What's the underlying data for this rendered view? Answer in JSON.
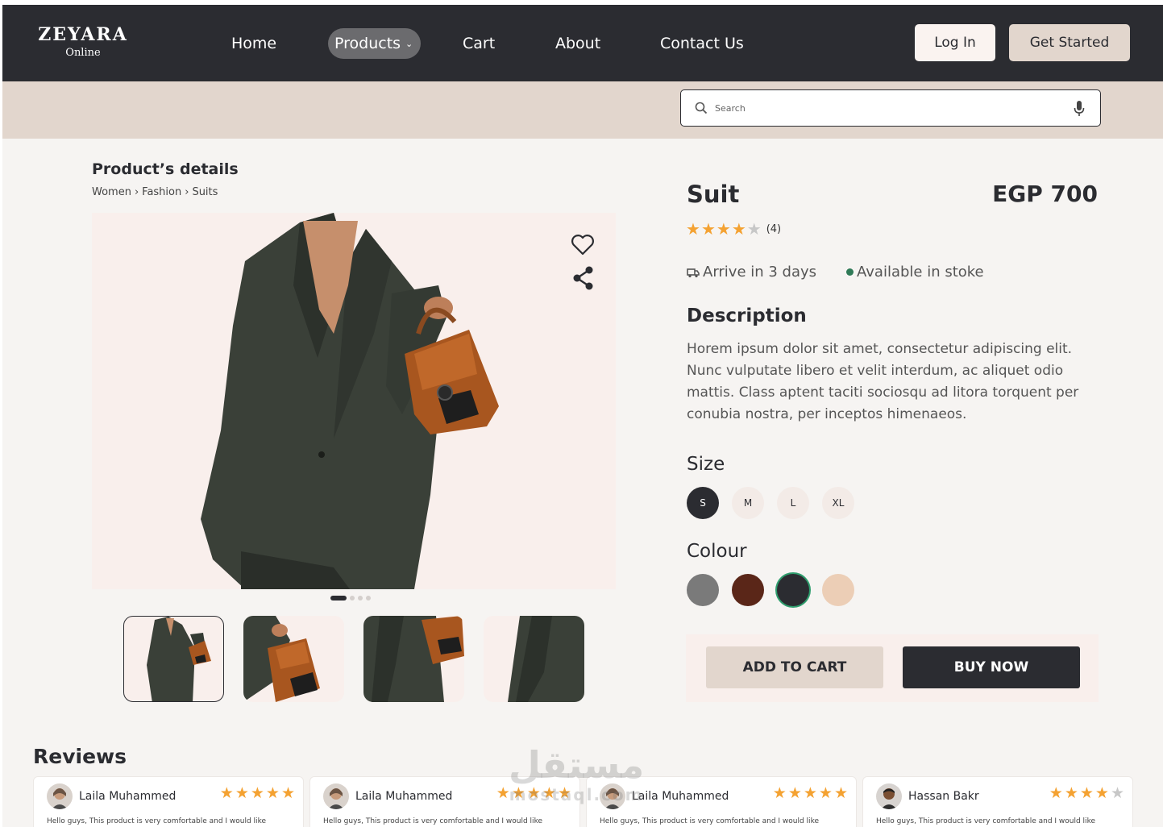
{
  "brand": {
    "name": "ZEYARA",
    "sub": "Online"
  },
  "nav": {
    "links": [
      "Home",
      "Products",
      "Cart",
      "About",
      "Contact Us"
    ],
    "active": "Products",
    "login": "Log In",
    "get_started": "Get Started"
  },
  "search": {
    "placeholder": "Search"
  },
  "product": {
    "section_title": "Product’s details",
    "breadcrumb": [
      "Women",
      "Fashion",
      "Suits"
    ],
    "name": "Suit",
    "price": "EGP 700",
    "rating": 4,
    "rating_max": 5,
    "rating_count": "(4)",
    "delivery": "Arrive in 3 days",
    "stock": "Available in stoke",
    "description_title": "Description",
    "description": "Horem ipsum dolor sit amet, consectetur adipiscing elit. Nunc vulputate libero et velit interdum, ac aliquet odio mattis. Class aptent taciti sociosqu ad litora torquent per conubia nostra, per inceptos himenaeos.",
    "size_title": "Size",
    "sizes": [
      "S",
      "M",
      "L",
      "XL"
    ],
    "selected_size": "S",
    "colour_title": "Colour",
    "colours": [
      "#7a7a7a",
      "#5a2618",
      "#2b2c31",
      "#ecceb6"
    ],
    "selected_colour": "#2b2c31",
    "gallery_index": 1,
    "gallery_count": 4,
    "add_to_cart": "ADD TO CART",
    "buy_now": "BUY NOW"
  },
  "reviews": {
    "title": "Reviews",
    "items": [
      {
        "name": "Laila Muhammed",
        "stars": 5,
        "text": "Hello guys, This product is very comfortable and I would like"
      },
      {
        "name": "Laila Muhammed",
        "stars": 5,
        "text": "Hello guys, This product is very comfortable and I would like"
      },
      {
        "name": "Laila Muhammed",
        "stars": 5,
        "text": "Hello guys, This product is very comfortable and I would like"
      },
      {
        "name": "Hassan Bakr",
        "stars": 4,
        "text": "Hello guys, This product is very comfortable and I would like"
      }
    ]
  },
  "watermark": {
    "arabic": "مستقل",
    "latin": "mostaql.com"
  },
  "colors": {
    "dark": "#2b2c31",
    "beige": "#e2d6cd",
    "blush": "#f9efec",
    "star": "#f4a232",
    "stock": "#2f7a57"
  }
}
